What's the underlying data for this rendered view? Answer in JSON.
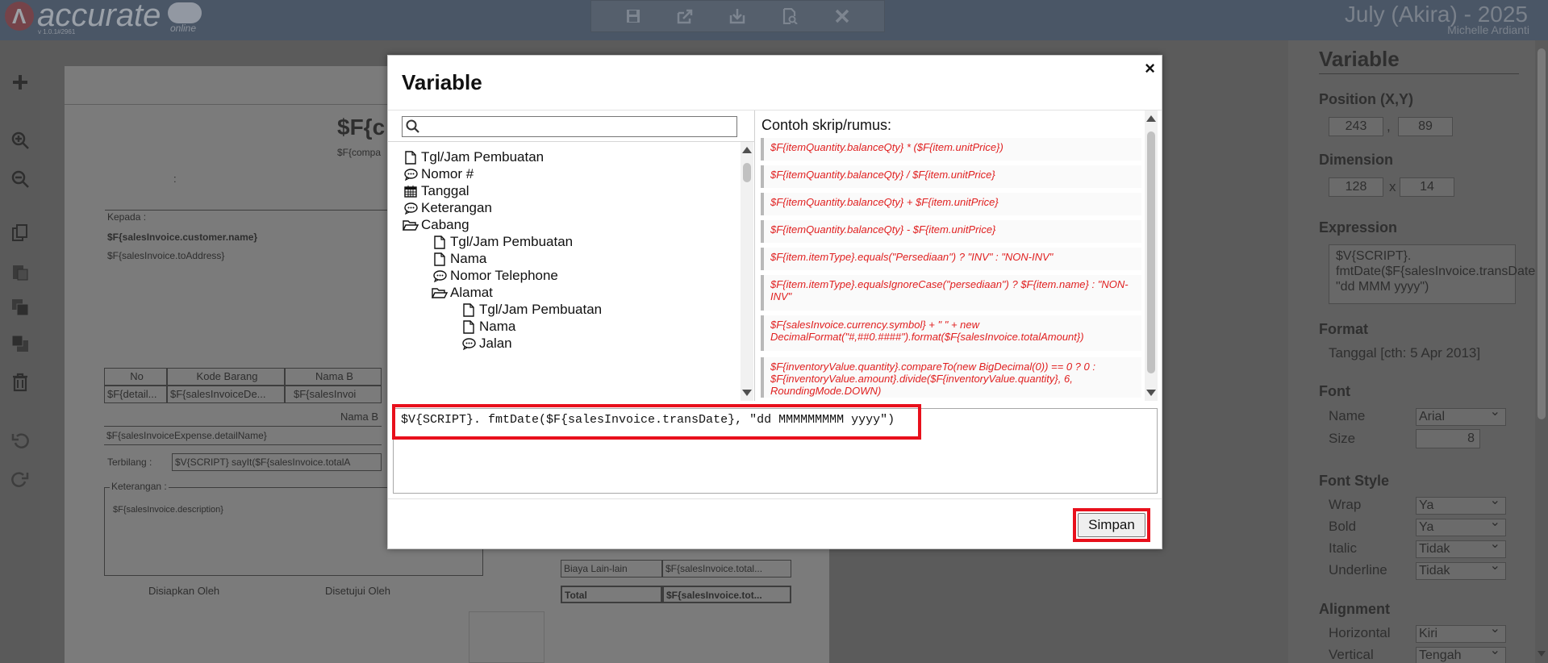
{
  "app": {
    "logo_text": "accurate",
    "logo_sub": "online",
    "version": "v 1.0.1#2961",
    "company": "July (Akira) - 2025",
    "user": "Michelle Ardianti"
  },
  "toolbar_icons": [
    "save-icon",
    "export-icon",
    "import-icon",
    "preview-icon",
    "close-icon"
  ],
  "left_tools": [
    "add-icon",
    "zoom-in-icon",
    "zoom-out-icon",
    "copy-icon",
    "paste-icon",
    "bring-front-icon",
    "send-back-icon",
    "delete-icon",
    "undo-icon",
    "redo-icon"
  ],
  "canvas": {
    "title_var": "$F{c",
    "company_var": "$F{compa",
    "colon": ":",
    "kepada_label": "Kepada :",
    "customer_name": "$F{salesInvoice.customer.name}",
    "to_address": "$F{salesInvoice.toAddress}",
    "table_headers": [
      "No",
      "Kode Barang",
      "Nama B"
    ],
    "table_row": [
      "$F{detail...",
      "$F{salesInvoiceDe...",
      "$F{salesInvoi"
    ],
    "expense_header": "Nama B",
    "expense_row": "$F{salesInvoiceExpense.detailName}",
    "terbilang_label": "Terbilang :",
    "terbilang_value": "$V{SCRIPT} sayIt($F{salesInvoice.totalA",
    "keterangan_label": "Keterangan :",
    "description": "$F{salesInvoice.description}",
    "biaya_label": "Biaya Lain-lain",
    "biaya_value": "$F{salesInvoice.total...",
    "total_label": "Total",
    "total_value": "$F{salesInvoice.tot...",
    "disiapkan": "Disiapkan Oleh",
    "disetujui": "Disetujui Oleh"
  },
  "panel": {
    "title": "Variable",
    "position_label": "Position (X,Y)",
    "pos_x": "243",
    "pos_sep": ",",
    "pos_y": "89",
    "dimension_label": "Dimension",
    "dim_w": "128",
    "dim_sep": "x",
    "dim_h": "14",
    "expression_label": "Expression",
    "expression_value": "$V{SCRIPT}. fmtDate($F{salesInvoice.transDate}, \"dd MMM yyyy\")",
    "format_label": "Format",
    "format_value": "Tanggal [cth: 5 Apr 2013]",
    "font_label": "Font",
    "font_name_label": "Name",
    "font_name_value": "Arial",
    "font_size_label": "Size",
    "font_size_value": "8",
    "font_style_label": "Font Style",
    "wrap_label": "Wrap",
    "wrap_value": "Ya",
    "bold_label": "Bold",
    "bold_value": "Ya",
    "italic_label": "Italic",
    "italic_value": "Tidak",
    "underline_label": "Underline",
    "underline_value": "Tidak",
    "alignment_label": "Alignment",
    "horizontal_label": "Horizontal",
    "horizontal_value": "Kiri",
    "vertical_label": "Vertical",
    "vertical_value": "Tengah"
  },
  "modal": {
    "title": "Variable",
    "close_label": "×",
    "search_placeholder": "",
    "tree": [
      {
        "label": "Tgl/Jam Pembuatan",
        "icon": "file-icon",
        "level": 0
      },
      {
        "label": "Nomor #",
        "icon": "comment-icon",
        "level": 0
      },
      {
        "label": "Tanggal",
        "icon": "calendar-icon",
        "level": 0
      },
      {
        "label": "Keterangan",
        "icon": "comment-icon",
        "level": 0
      },
      {
        "label": "Cabang",
        "icon": "folder-open-icon",
        "level": 0
      },
      {
        "label": "Tgl/Jam Pembuatan",
        "icon": "file-icon",
        "level": 1
      },
      {
        "label": "Nama",
        "icon": "file-icon",
        "level": 1
      },
      {
        "label": "Nomor Telephone",
        "icon": "comment-icon",
        "level": 1
      },
      {
        "label": "Alamat",
        "icon": "folder-open-icon",
        "level": 1
      },
      {
        "label": "Tgl/Jam Pembuatan",
        "icon": "file-icon",
        "level": 2
      },
      {
        "label": "Nama",
        "icon": "file-icon",
        "level": 2
      },
      {
        "label": "Jalan",
        "icon": "comment-icon",
        "level": 2
      }
    ],
    "examples_title": "Contoh skrip/rumus:",
    "examples": [
      "$F{itemQuantity.balanceQty} * ($F{item.unitPrice})",
      "$F{itemQuantity.balanceQty} / $F{item.unitPrice}",
      "$F{itemQuantity.balanceQty} + $F{item.unitPrice}",
      "$F{itemQuantity.balanceQty} - $F{item.unitPrice}",
      "$F{item.itemType}.equals(\"Persediaan\") ? \"INV\" : \"NON-INV\"",
      "$F{item.itemType}.equalsIgnoreCase(\"persediaan\") ? $F{item.name} : \"NON-INV\"",
      "$F{salesInvoice.currency.symbol} + \" \" + new DecimalFormat(\"#,##0.####\").format($F{salesInvoice.totalAmount})",
      "$F{inventoryValue.quantity}.compareTo(new BigDecimal(0)) == 0 ? 0 : $F{inventoryValue.amount}.divide($F{inventoryValue.quantity}, 6, RoundingMode.DOWN)"
    ],
    "expression": "$V{SCRIPT}. fmtDate($F{salesInvoice.transDate}, \"dd MMMMMMMMM yyyy\")",
    "save_label": "Simpan"
  },
  "colors": {
    "highlight": "#e8101c",
    "example_text": "#e02020",
    "topbar": "#4a5666"
  }
}
